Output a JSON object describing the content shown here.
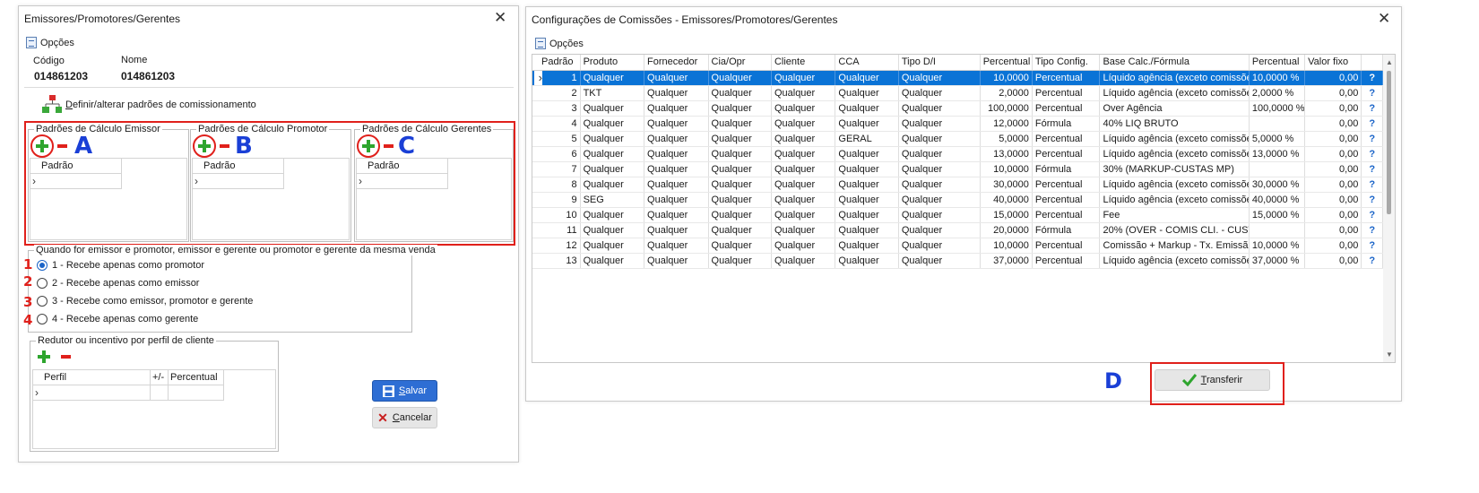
{
  "left_window": {
    "title": "Emissores/Promotores/Gerentes",
    "opcoes": "Opções",
    "codigo_label": "Código",
    "nome_label": "Nome",
    "codigo_value": "014861203",
    "nome_value": "014861203",
    "define_link_prefix": "D",
    "define_link_rest": "efinir/alterar padrões de comissionamento",
    "groups": [
      {
        "legend": "Padrões de Cálculo Emissor",
        "column": "Padrão",
        "marker": "A"
      },
      {
        "legend": "Padrões de Cálculo  Promotor",
        "column": "Padrão",
        "marker": "B"
      },
      {
        "legend": "Padrões de Cálculo Gerentes",
        "column": "Padrão",
        "marker": "C"
      }
    ],
    "radio_group_legend": "Quando for emissor e promotor, emissor e gerente ou promotor e gerente da mesma venda",
    "radio_options": [
      {
        "num": "1",
        "label": "1 - Recebe apenas como promotor",
        "checked": true
      },
      {
        "num": "2",
        "label": "2 - Recebe apenas como emissor",
        "checked": false
      },
      {
        "num": "3",
        "label": "3 - Recebe como emissor, promotor e gerente",
        "checked": false
      },
      {
        "num": "4",
        "label": "4 - Recebe apenas como gerente",
        "checked": false
      }
    ],
    "redutor_legend": "Redutor ou incentivo por perfil de cliente",
    "redutor_columns": [
      "Perfil",
      "+/-",
      "Percentual"
    ],
    "save_prefix": "S",
    "save_rest": "alvar",
    "cancel_prefix": "C",
    "cancel_rest": "ancelar"
  },
  "right_window": {
    "title": "Configurações de Comissões - Emissores/Promotores/Gerentes",
    "opcoes": "Opções",
    "columns": [
      "Padrão",
      "Produto",
      "Fornecedor",
      "Cia/Opr",
      "Cliente",
      "CCA",
      "Tipo D/I",
      "Percentual",
      "Tipo Config.",
      "Base Calc./Fórmula",
      "Percentual",
      "Valor fixo",
      ""
    ],
    "rows": [
      [
        "1",
        "Qualquer",
        "Qualquer",
        "Qualquer",
        "Qualquer",
        "Qualquer",
        "Qualquer",
        "10,0000",
        "Percentual",
        "Líquido agência (exceto comissões d",
        "10,0000 %",
        "0,00",
        "?"
      ],
      [
        "2",
        "TKT",
        "Qualquer",
        "Qualquer",
        "Qualquer",
        "Qualquer",
        "Qualquer",
        "2,0000",
        "Percentual",
        "Líquido agência (exceto comissões d",
        "2,0000 %",
        "0,00",
        "?"
      ],
      [
        "3",
        "Qualquer",
        "Qualquer",
        "Qualquer",
        "Qualquer",
        "Qualquer",
        "Qualquer",
        "100,0000",
        "Percentual",
        "Over Agência",
        "100,0000 %",
        "0,00",
        "?"
      ],
      [
        "4",
        "Qualquer",
        "Qualquer",
        "Qualquer",
        "Qualquer",
        "Qualquer",
        "Qualquer",
        "12,0000",
        "Fórmula",
        "40% LIQ BRUTO",
        "",
        "0,00",
        "?"
      ],
      [
        "5",
        "Qualquer",
        "Qualquer",
        "Qualquer",
        "Qualquer",
        "GERAL",
        "Qualquer",
        "5,0000",
        "Percentual",
        "Líquido agência (exceto comissões d",
        "5,0000 %",
        "0,00",
        "?"
      ],
      [
        "6",
        "Qualquer",
        "Qualquer",
        "Qualquer",
        "Qualquer",
        "Qualquer",
        "Qualquer",
        "13,0000",
        "Percentual",
        "Líquido agência (exceto comissões d",
        "13,0000 %",
        "0,00",
        "?"
      ],
      [
        "7",
        "Qualquer",
        "Qualquer",
        "Qualquer",
        "Qualquer",
        "Qualquer",
        "Qualquer",
        "10,0000",
        "Fórmula",
        "30% (MARKUP-CUSTAS MP)",
        "",
        "0,00",
        "?"
      ],
      [
        "8",
        "Qualquer",
        "Qualquer",
        "Qualquer",
        "Qualquer",
        "Qualquer",
        "Qualquer",
        "30,0000",
        "Percentual",
        "Líquido agência (exceto comissões d",
        "30,0000 %",
        "0,00",
        "?"
      ],
      [
        "9",
        "SEG",
        "Qualquer",
        "Qualquer",
        "Qualquer",
        "Qualquer",
        "Qualquer",
        "40,0000",
        "Percentual",
        "Líquido agência (exceto comissões d",
        "40,0000 %",
        "0,00",
        "?"
      ],
      [
        "10",
        "Qualquer",
        "Qualquer",
        "Qualquer",
        "Qualquer",
        "Qualquer",
        "Qualquer",
        "15,0000",
        "Percentual",
        "Fee",
        "15,0000 %",
        "0,00",
        "?"
      ],
      [
        "11",
        "Qualquer",
        "Qualquer",
        "Qualquer",
        "Qualquer",
        "Qualquer",
        "Qualquer",
        "20,0000",
        "Fórmula",
        "20% (OVER - COMIS CLI. - CUSTAS",
        "",
        "0,00",
        "?"
      ],
      [
        "12",
        "Qualquer",
        "Qualquer",
        "Qualquer",
        "Qualquer",
        "Qualquer",
        "Qualquer",
        "10,0000",
        "Percentual",
        "Comissão + Markup - Tx. Emissão -",
        "10,0000 %",
        "0,00",
        "?"
      ],
      [
        "13",
        "Qualquer",
        "Qualquer",
        "Qualquer",
        "Qualquer",
        "Qualquer",
        "Qualquer",
        "37,0000",
        "Percentual",
        "Líquido agência (exceto comissões d",
        "37,0000 %",
        "0,00",
        "?"
      ]
    ],
    "selected_row": 0,
    "marker": "D",
    "transfer_prefix": "T",
    "transfer_rest": "ransferir"
  },
  "colors": {
    "accent": "#0a73d6",
    "annotation_red": "#e0201b",
    "annotation_blue": "#1a3fd6",
    "add_green": "#2ea52e"
  }
}
